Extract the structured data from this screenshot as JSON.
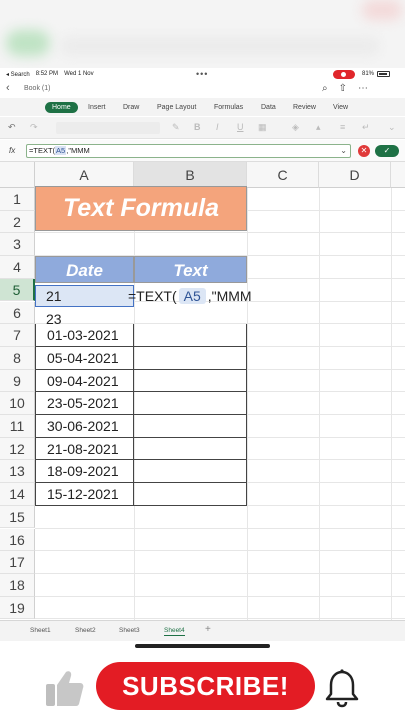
{
  "status_bar": {
    "back_label": "◂ Search",
    "time": "8:52 PM",
    "date": "Wed 1 Nov",
    "center_dots": "•••",
    "battery": "81%"
  },
  "title_bar": {
    "book_title": "Book (1)"
  },
  "ribbon": {
    "tabs": [
      "Home",
      "Insert",
      "Draw",
      "Page Layout",
      "Formulas",
      "Data",
      "Review",
      "View"
    ],
    "active": "Home"
  },
  "toolbar": {
    "bold": "B",
    "italic": "I",
    "underline": "U"
  },
  "formula_bar": {
    "fx": "fx",
    "prefix": "=TEXT(",
    "ref": "A5",
    "suffix": ",\"MMM"
  },
  "grid": {
    "columns": [
      "A",
      "B",
      "C",
      "D"
    ],
    "rows": [
      "1",
      "2",
      "3",
      "4",
      "5",
      "6",
      "7",
      "8",
      "9",
      "10",
      "11",
      "12",
      "13",
      "14",
      "15",
      "16",
      "17",
      "18",
      "19"
    ],
    "title": "Text Formula",
    "header_date": "Date",
    "header_text": "Text",
    "a5": "21",
    "a6": "23",
    "dates": [
      "01-03-2021",
      "05-04-2021",
      "09-04-2021",
      "23-05-2021",
      "30-06-2021",
      "21-08-2021",
      "18-09-2021",
      "15-12-2021"
    ],
    "edit_prefix": "=TEXT(",
    "edit_ref": "A5",
    "edit_suffix": ",\"MMM"
  },
  "sheets": {
    "tabs": [
      "Sheet1",
      "Sheet2",
      "Sheet3",
      "Sheet4"
    ],
    "active": "Sheet4",
    "add": "+"
  },
  "overlay": {
    "subscribe": "SUBSCRIBE!"
  },
  "colors": {
    "accent": "#1e7145",
    "title_fill": "#f4a47c",
    "header_fill": "#8faadc",
    "subscribe": "#e31c24"
  }
}
